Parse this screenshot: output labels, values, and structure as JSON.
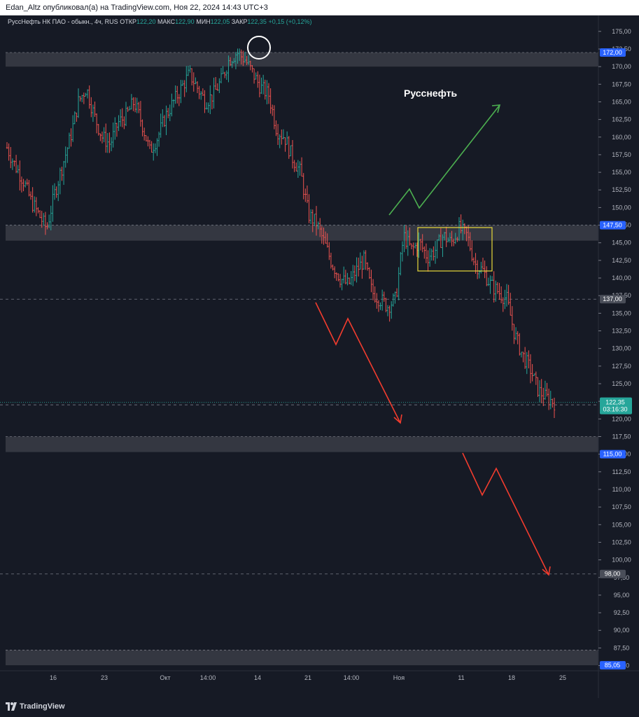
{
  "header": {
    "publish_line": "Edan_Altz опубликовал(а) на TradingView.com, Ноя 22, 2024 14:43 UTC+3"
  },
  "legend": {
    "symbol": "РуссНефть НК ПАО - обыкн., 4ч, RUS",
    "open_label": "ОТКР",
    "open_value": "122,20",
    "high_label": "МАКС",
    "high_value": "122,90",
    "low_label": "МИН",
    "low_value": "122,05",
    "close_label": "ЗАКР",
    "close_value": "122,35",
    "change": "+0,15 (+0,12%)"
  },
  "annotation": {
    "title": "Русснефть"
  },
  "price_axis": {
    "ticks": [
      "175,00",
      "172,50",
      "170,00",
      "167,50",
      "165,00",
      "162,50",
      "160,00",
      "157,50",
      "155,00",
      "152,50",
      "150,00",
      "147,50",
      "145,00",
      "142,50",
      "140,00",
      "137,50",
      "135,00",
      "132,50",
      "130,00",
      "127,50",
      "125,00",
      "122,50",
      "120,00",
      "117,50",
      "115,00",
      "112,50",
      "110,00",
      "107,50",
      "105,00",
      "102,50",
      "100,00",
      "97,50",
      "95,00",
      "92,50",
      "90,00",
      "87,50",
      "85,00"
    ],
    "badges": [
      {
        "label": "172,00",
        "price": 172,
        "color": "#2962ff"
      },
      {
        "label": "147,50",
        "price": 147.5,
        "color": "#2962ff"
      },
      {
        "label": "137,00",
        "price": 137,
        "color": "#4a4e59"
      },
      {
        "label": "122,00",
        "price": 122,
        "color": "#4a4e59"
      },
      {
        "label": "115,00",
        "price": 115,
        "color": "#2962ff"
      },
      {
        "label": "98,00",
        "price": 98,
        "color": "#4a4e59"
      },
      {
        "label": "85,05",
        "price": 85.05,
        "color": "#2962ff"
      }
    ],
    "last_price": {
      "label": "122,35",
      "price": 122.35,
      "timer": "03:16:30",
      "color": "#26a69a"
    }
  },
  "time_axis": {
    "labels": [
      "16",
      "23",
      "Окт",
      "14:00",
      "14",
      "21",
      "14:00",
      "Ноя",
      "11",
      "18",
      "25"
    ]
  },
  "footer": {
    "brand": "TradingView"
  },
  "colors": {
    "up": "#26a69a",
    "down": "#ef5350",
    "zone": "#3a3d47",
    "green_arrow": "#4caf50",
    "red_arrow": "#f23c2e",
    "rect": "#e8d93a"
  },
  "icons": {
    "logo": "tradingview-logo-icon"
  },
  "chart_data": {
    "type": "candlestick",
    "timeframe": "4h",
    "ylim": [
      84,
      177
    ],
    "price_data": [
      158.5,
      156,
      154,
      151,
      149,
      147,
      152,
      156,
      160,
      165,
      167,
      163,
      160,
      159,
      162,
      163,
      165,
      162,
      158,
      160,
      163,
      165,
      167,
      169,
      167,
      165,
      166,
      168,
      171,
      172,
      171,
      169,
      167,
      166,
      161,
      160,
      157,
      155,
      149,
      147.8,
      145,
      142,
      140,
      139,
      141,
      142.5,
      138,
      137,
      136,
      137,
      146,
      144,
      145,
      143,
      144,
      146,
      145,
      147,
      146,
      142,
      141,
      139,
      138,
      137,
      132,
      129,
      127,
      124,
      123,
      122.35
    ],
    "zones": [
      [
        170,
        172
      ],
      [
        145.3,
        147.5
      ],
      [
        115.3,
        117.5
      ],
      [
        85.05,
        87.2
      ]
    ],
    "dashed_levels": [
      137,
      122,
      98
    ],
    "last_price": 122.35
  }
}
